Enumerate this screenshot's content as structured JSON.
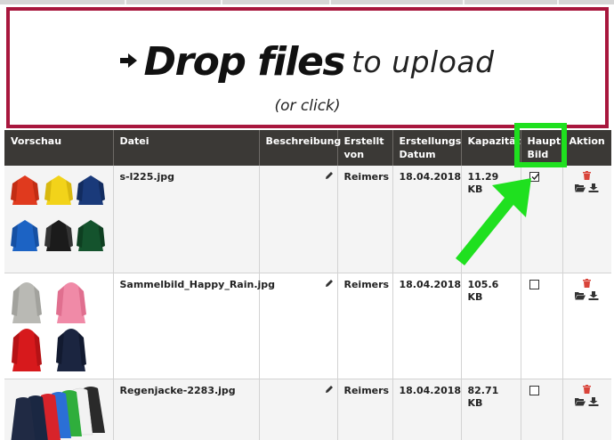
{
  "dropzone": {
    "title_strong": "Drop files",
    "title_light": "to upload",
    "subtitle": "(or click)"
  },
  "table": {
    "headers": {
      "preview": "Vorschau",
      "file": "Datei",
      "description": "Beschreibung",
      "created_by": "Erstellt von",
      "created_date": "Erstellungs Datum",
      "size": "Kapazität",
      "main_image": "Haupt Bild",
      "action": "Aktion"
    },
    "rows": [
      {
        "file": "s-l225.jpg",
        "created_by": "Reimers",
        "date": "18.04.2018",
        "size": "11.29 KB",
        "main_image": true
      },
      {
        "file": "Sammelbild_Happy_Rain.jpg",
        "created_by": "Reimers",
        "date": "18.04.2018",
        "size": "105.6 KB",
        "main_image": false
      },
      {
        "file": "Regenjacke-2283.jpg",
        "created_by": "Reimers",
        "date": "18.04.2018",
        "size": "82.71 KB",
        "main_image": false
      }
    ]
  },
  "colors": {
    "dropzone_border": "#a8173d",
    "header_bg": "#3b3936",
    "highlight": "#1fe01f",
    "delete_icon": "#d9443a"
  },
  "icons": [
    "arrow-right-icon",
    "pencil-icon",
    "checkbox-icon",
    "trash-icon",
    "folder-open-icon",
    "download-icon",
    "highlight-arrow-icon"
  ]
}
